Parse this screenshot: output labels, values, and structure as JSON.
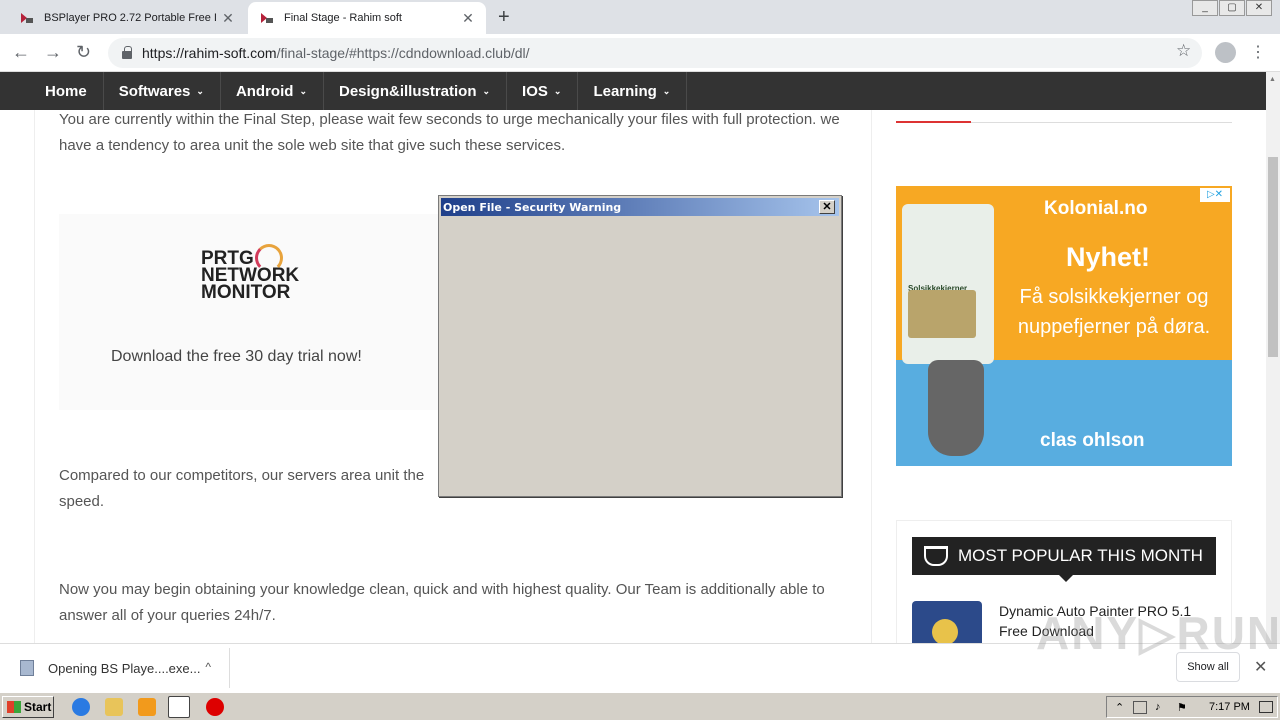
{
  "browser": {
    "tabs": [
      {
        "title": "BSPlayer PRO 2.72 Portable Free Do",
        "close": "✕",
        "active": false
      },
      {
        "title": "Final Stage - Rahim soft",
        "close": "✕",
        "active": true
      }
    ],
    "new_tab": "+",
    "url_host": "https://rahim-soft.com",
    "url_rest": "/final-stage/#https://cdndownload.club/dl/"
  },
  "site_nav": {
    "items": [
      {
        "label": "Home",
        "caret": ""
      },
      {
        "label": "Softwares",
        "caret": "⌄"
      },
      {
        "label": "Android",
        "caret": "⌄"
      },
      {
        "label": "Design&illustration",
        "caret": "⌄"
      },
      {
        "label": "IOS",
        "caret": "⌄"
      },
      {
        "label": "Learning",
        "caret": "⌄"
      }
    ]
  },
  "content": {
    "p1": "You are currently within the Final Step, please wait few seconds to urge mechanically your files with full protection. we have a tendency to area unit the sole web site that give such these services.",
    "p2": "Compared to our competitors, our servers area unit the",
    "p2b": "speed.",
    "p3": "Now you may begin obtaining your knowledge clean, quick and with highest quality. Our Team is additionally able to answer all of your queries 24h/7.",
    "prtg_ad": {
      "logo_line1": "PRTG",
      "logo_line2": "NETWORK",
      "logo_line3": "MONITOR",
      "tagline": "Download the free 30 day trial now!"
    }
  },
  "sidebar": {
    "kolonial_ad": {
      "brand": "Kolonial.no",
      "headline": "Nyhet!",
      "sub": "Få solsikkekjerner og nuppefjerner på døra.",
      "bag_label": "Solsikkekjerner",
      "retailer": "clas ohlson",
      "adchoice": "▷✕"
    },
    "popular": {
      "heading": "MOST POPULAR THIS MONTH",
      "item_title": "Dynamic Auto Painter PRO 5.1 Free Download"
    }
  },
  "dialog": {
    "title": "Open File - Security Warning",
    "close": "✕"
  },
  "download_bar": {
    "file": "Opening BS Playe....exe...",
    "show_all": "Show all",
    "close": "✕"
  },
  "watermark": "ANY▷RUN",
  "taskbar": {
    "start": "Start",
    "clock": "7:17 PM"
  },
  "colors": {
    "nav_bg": "#333333",
    "ad_orange": "#f7a823",
    "ad_blue": "#58ade0",
    "dialog_bg": "#d4d0c8",
    "title_gradient_start": "#1f3f8a"
  }
}
